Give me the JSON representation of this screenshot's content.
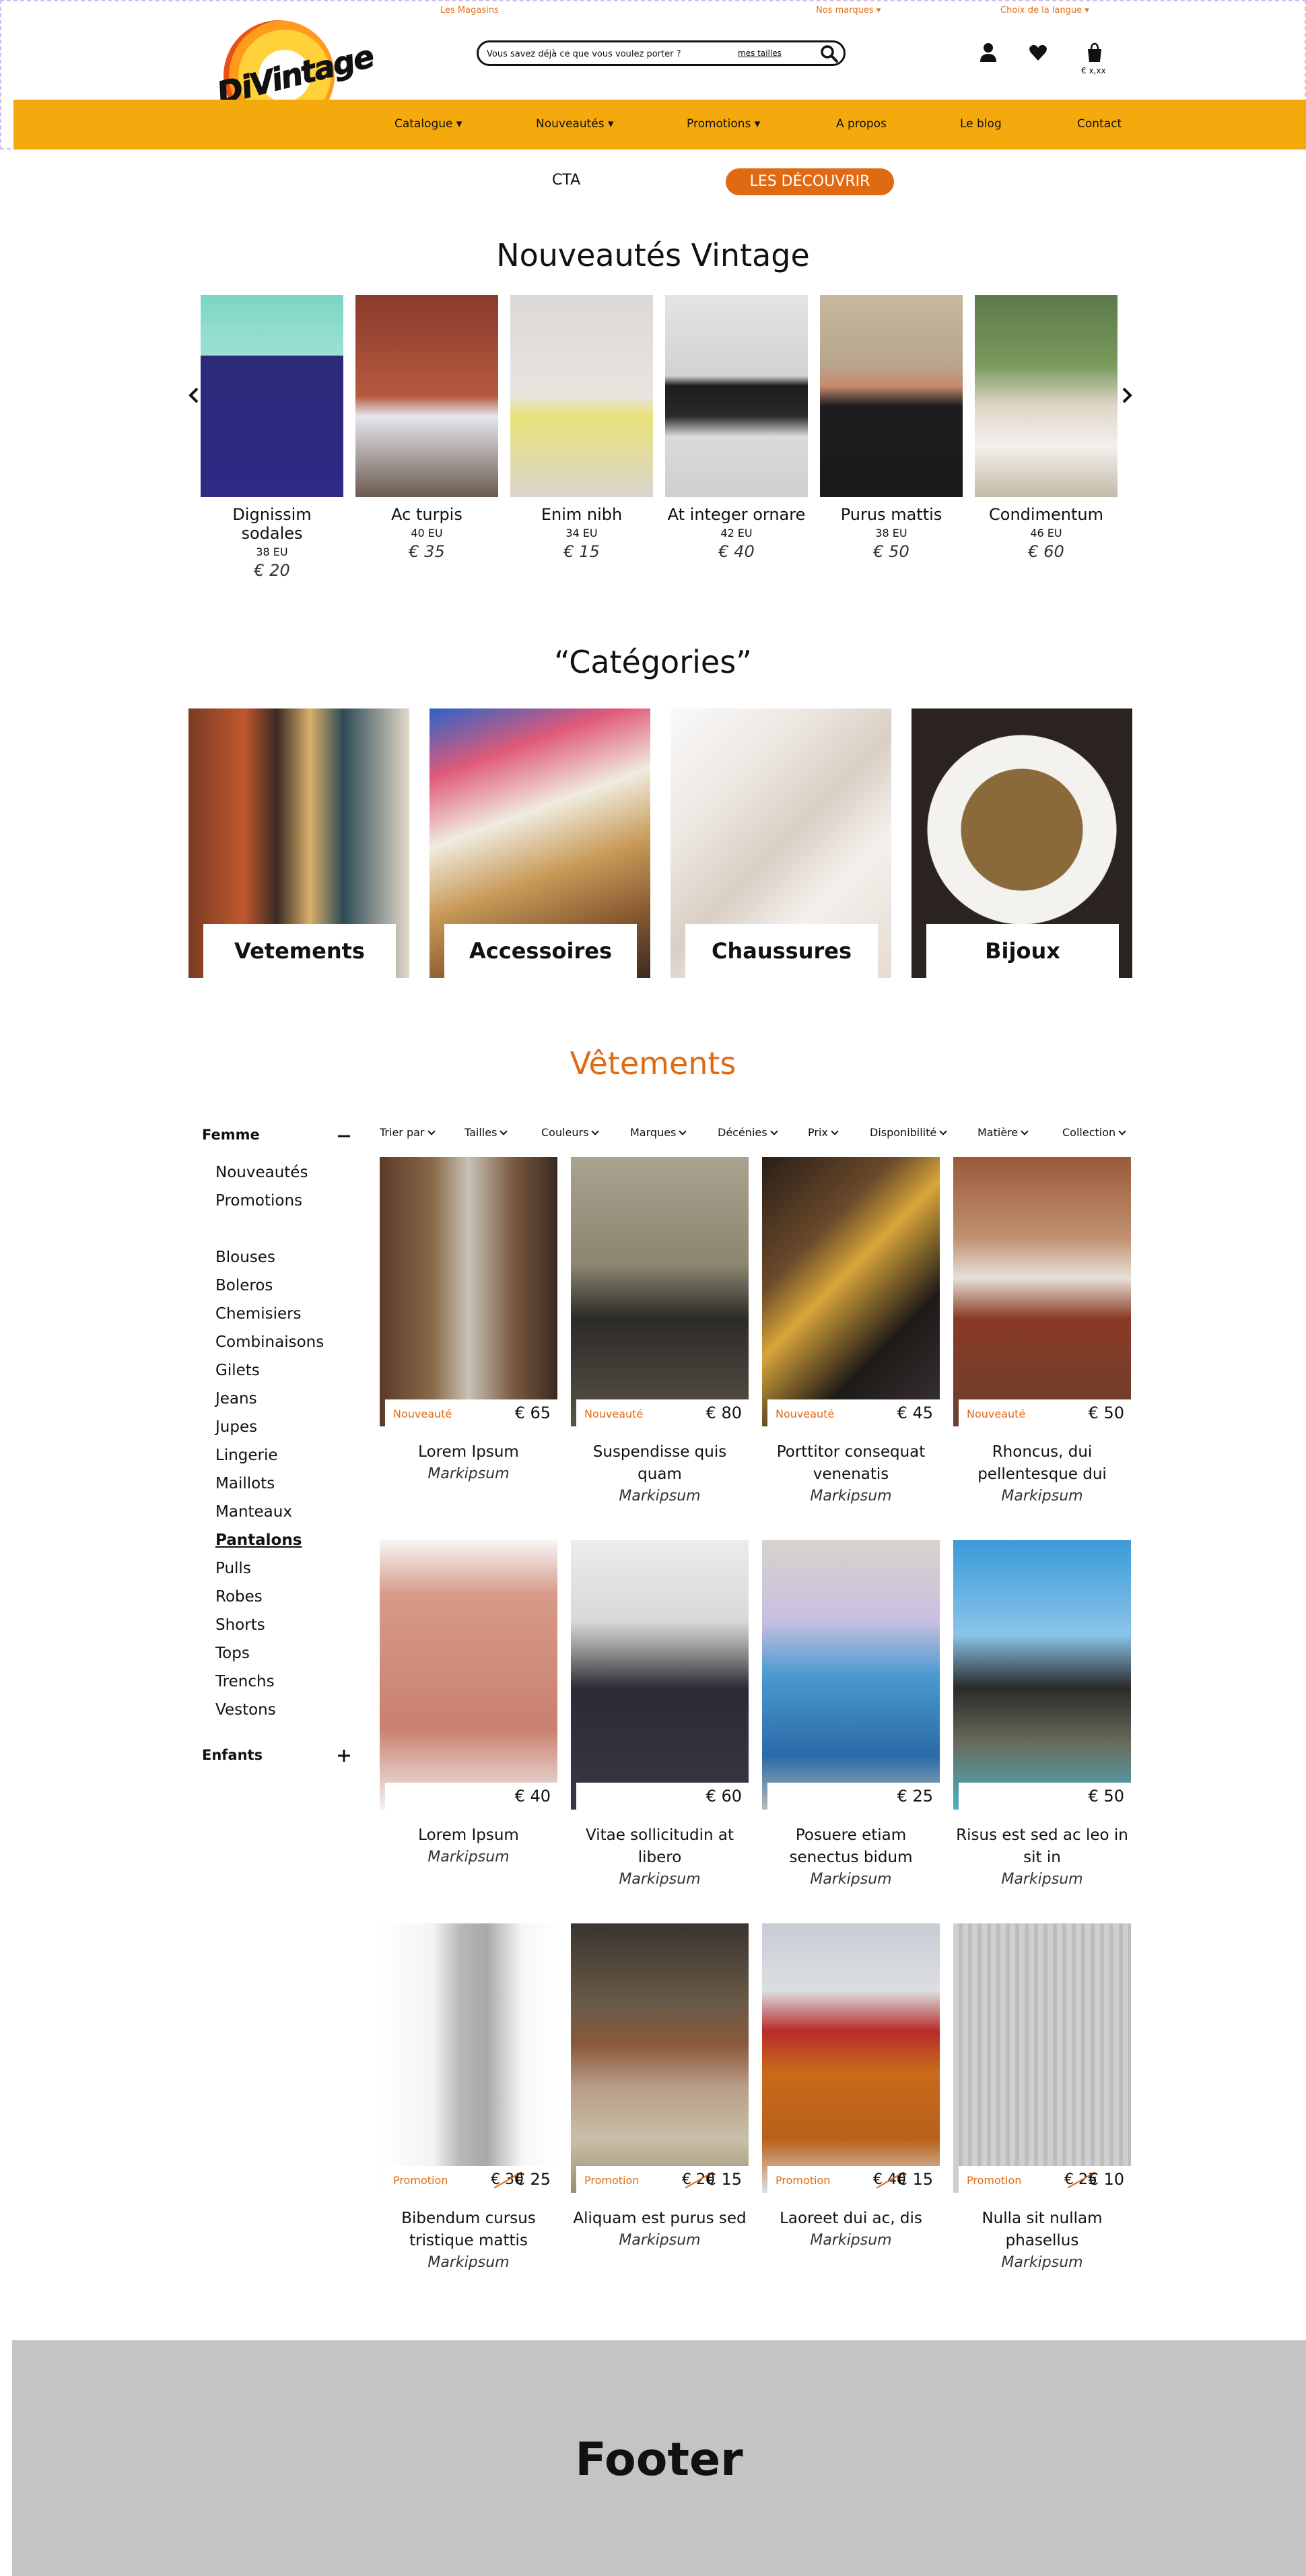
{
  "header": {
    "stores_link": "Les Magasins",
    "brands_link": "Nos marques",
    "language_link": "Choix de la langue",
    "logo_text": "DiVintage",
    "search_placeholder": "Vous savez déjà ce que vous voulez porter ?",
    "my_sizes": "mes tailles",
    "cart_total": "€ x,xx",
    "colors": {
      "nav_bg": "#f4a90c",
      "accent": "#e06a12"
    }
  },
  "nav": [
    "Catalogue",
    "Nouveautés",
    "Promotions",
    "A propos",
    "Le blog",
    "Contact"
  ],
  "cta": {
    "text": "CTA",
    "button": "LES DÉCOUVRIR"
  },
  "new_section": {
    "title": "Nouveautés Vintage",
    "products": [
      {
        "name": "Dignissim sodales",
        "eur": "38 EU",
        "price": "€ 20"
      },
      {
        "name": "Ac turpis",
        "eur": "40 EU",
        "price": "€ 35"
      },
      {
        "name": "Enim nibh",
        "eur": "34 EU",
        "price": "€ 15"
      },
      {
        "name": "At integer ornare",
        "eur": "42 EU",
        "price": "€ 40"
      },
      {
        "name": "Purus mattis",
        "eur": "38 EU",
        "price": "€ 50"
      },
      {
        "name": "Condimentum",
        "eur": "46 EU",
        "price": "€ 60"
      }
    ]
  },
  "categories": {
    "title": "“Catégories”",
    "items": [
      "Vetements",
      "Accessoires",
      "Chaussures",
      "Bijoux"
    ]
  },
  "clothing": {
    "title": "Vêtements",
    "sidebar": {
      "femme": "Femme",
      "enfants": "Enfants",
      "top_items": [
        "Nouveautés",
        "Promotions"
      ],
      "items": [
        "Blouses",
        "Boleros",
        "Chemisiers",
        "Combinaisons",
        "Gilets",
        "Jeans",
        "Jupes",
        "Lingerie",
        "Maillots",
        "Manteaux",
        "Pantalons",
        "Pulls",
        "Robes",
        "Shorts",
        "Tops",
        "Trenchs",
        "Vestons"
      ],
      "active": "Pantalons"
    },
    "filters": [
      "Trier par",
      "Tailles",
      "Couleurs",
      "Marques",
      "Décénies",
      "Prix",
      "Disponibilité",
      "Matière",
      "Collection"
    ],
    "products": [
      {
        "title": "Lorem Ipsum",
        "brand": "Markipsum",
        "badge": "Nouveauté",
        "price": "€ 65",
        "old": ""
      },
      {
        "title": "Suspendisse quis quam",
        "brand": "Markipsum",
        "badge": "Nouveauté",
        "price": "€ 80",
        "old": ""
      },
      {
        "title": "Porttitor consequat venenatis",
        "brand": "Markipsum",
        "badge": "Nouveauté",
        "price": "€ 45",
        "old": ""
      },
      {
        "title": "Rhoncus, dui pellentesque dui",
        "brand": "Markipsum",
        "badge": "Nouveauté",
        "price": "€ 50",
        "old": ""
      },
      {
        "title": "Lorem Ipsum",
        "brand": "Markipsum",
        "badge": "",
        "price": "€ 40",
        "old": ""
      },
      {
        "title": "Vitae sollicitudin at libero",
        "brand": "Markipsum",
        "badge": "",
        "price": "€ 60",
        "old": ""
      },
      {
        "title": "Posuere etiam senectus bidum",
        "brand": "Markipsum",
        "badge": "",
        "price": "€ 25",
        "old": ""
      },
      {
        "title": "Risus est sed ac leo in sit in",
        "brand": "Markipsum",
        "badge": "",
        "price": "€ 50",
        "old": ""
      },
      {
        "title": "Bibendum cursus tristique mattis",
        "brand": "Markipsum",
        "badge": "Promotion",
        "price": "€ 25",
        "old": "€ 30"
      },
      {
        "title": "Aliquam est purus sed",
        "brand": "Markipsum",
        "badge": "Promotion",
        "price": "€ 15",
        "old": "€ 20"
      },
      {
        "title": "Laoreet dui ac, dis",
        "brand": "Markipsum",
        "badge": "Promotion",
        "price": "€ 15",
        "old": "€ 40"
      },
      {
        "title": "Nulla sit nullam phasellus",
        "brand": "Markipsum",
        "badge": "Promotion",
        "price": "€ 10",
        "old": "€ 25"
      }
    ]
  },
  "footer": {
    "title": "Footer"
  }
}
